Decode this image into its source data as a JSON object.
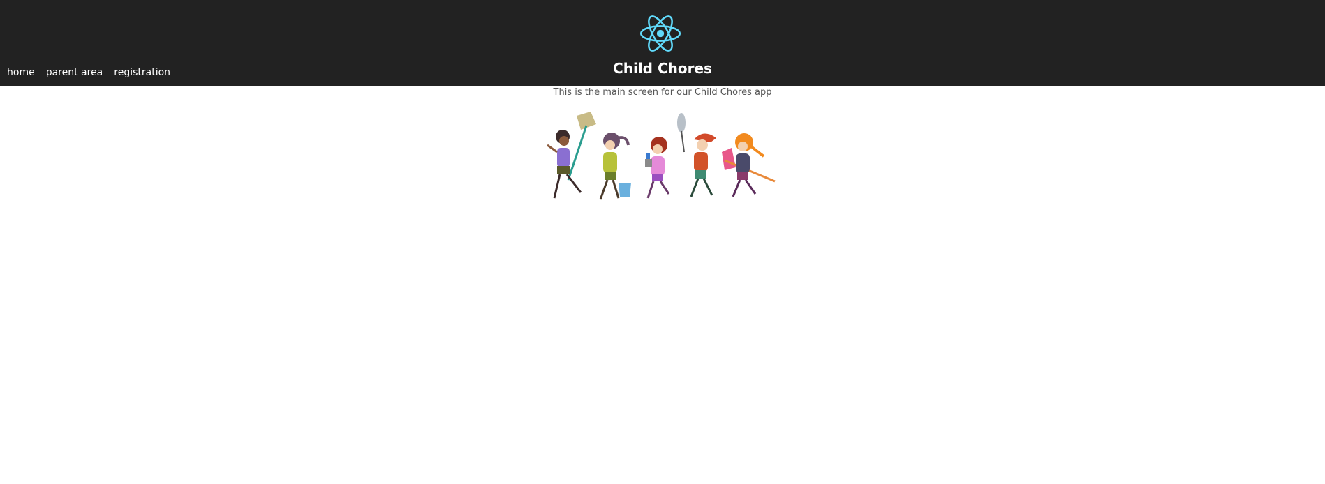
{
  "header": {
    "title": "Child Chores",
    "logo_icon": "react-atom-icon",
    "logo_color": "#61dafb",
    "background": "#222222",
    "nav": [
      {
        "label": "home"
      },
      {
        "label": "parent area"
      },
      {
        "label": "registration"
      }
    ]
  },
  "main": {
    "intro": "This is the main screen for our Child Chores app",
    "illustration_icon": "children-doing-chores-illustration"
  }
}
